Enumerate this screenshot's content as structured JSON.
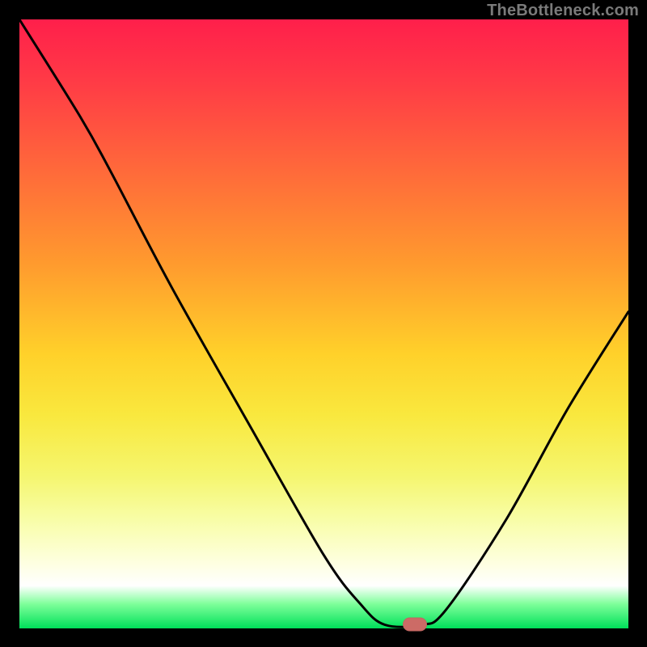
{
  "watermark": "TheBottleneck.com",
  "colors": {
    "page_bg": "#000000",
    "marker": "#cc6b66",
    "curve": "#000000"
  },
  "chart_data": {
    "type": "line",
    "title": "",
    "xlabel": "",
    "ylabel": "",
    "xlim": [
      0,
      100
    ],
    "ylim": [
      0,
      100
    ],
    "grid": false,
    "curve_points": [
      {
        "x": 0,
        "y": 100
      },
      {
        "x": 10,
        "y": 84
      },
      {
        "x": 15,
        "y": 75
      },
      {
        "x": 25,
        "y": 56
      },
      {
        "x": 38,
        "y": 33
      },
      {
        "x": 50,
        "y": 12
      },
      {
        "x": 56,
        "y": 4
      },
      {
        "x": 60,
        "y": 0.6
      },
      {
        "x": 66,
        "y": 0.6
      },
      {
        "x": 70,
        "y": 3
      },
      {
        "x": 80,
        "y": 18
      },
      {
        "x": 90,
        "y": 36
      },
      {
        "x": 100,
        "y": 52
      }
    ],
    "marker": {
      "x": 65,
      "y": 0.6
    }
  }
}
